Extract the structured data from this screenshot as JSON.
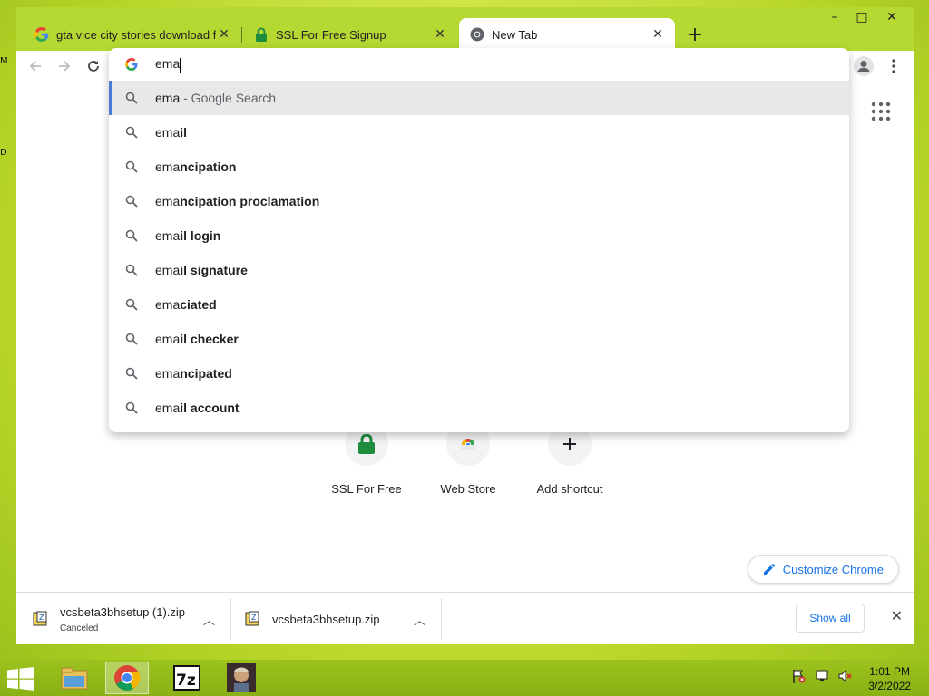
{
  "desktop": {
    "fragments": [
      "M",
      "D"
    ]
  },
  "window": {
    "controls": {
      "minimize": "–",
      "maximize": "□",
      "close": "✕"
    },
    "tabs": [
      {
        "title": "gta vice city stories download for",
        "icon": "google-g-icon"
      },
      {
        "title": "SSL For Free Signup",
        "icon": "green-lock-icon"
      },
      {
        "title": "New Tab",
        "icon": "chrome-icon"
      }
    ],
    "new_tab_label": "+"
  },
  "omnibox": {
    "query": "ema",
    "suggestions": [
      {
        "typed": "ema",
        "rest": "",
        "hint": " - Google Search"
      },
      {
        "typed": "ema",
        "rest": "il",
        "hint": ""
      },
      {
        "typed": "ema",
        "rest": "ncipation",
        "hint": ""
      },
      {
        "typed": "ema",
        "rest": "ncipation proclamation",
        "hint": ""
      },
      {
        "typed": "ema",
        "rest": "il login",
        "hint": ""
      },
      {
        "typed": "ema",
        "rest": "il signature",
        "hint": ""
      },
      {
        "typed": "ema",
        "rest": "ciated",
        "hint": ""
      },
      {
        "typed": "ema",
        "rest": "il checker",
        "hint": ""
      },
      {
        "typed": "ema",
        "rest": "ncipated",
        "hint": ""
      },
      {
        "typed": "ema",
        "rest": "il account",
        "hint": ""
      }
    ]
  },
  "shortcuts": [
    {
      "label": "SSL For Free",
      "icon": "green-lock-icon"
    },
    {
      "label": "Web Store",
      "icon": "web-store-icon"
    },
    {
      "label": "Add shortcut",
      "icon": "plus-icon"
    }
  ],
  "customize_label": "Customize Chrome",
  "downloads": {
    "items": [
      {
        "filename": "vcsbeta3bhsetup (1).zip",
        "status": "Canceled"
      },
      {
        "filename": "vcsbeta3bhsetup.zip",
        "status": ""
      }
    ],
    "show_all_label": "Show all"
  },
  "taskbar": {
    "clock_time": "1:01 PM",
    "clock_date": "3/2/2022"
  }
}
